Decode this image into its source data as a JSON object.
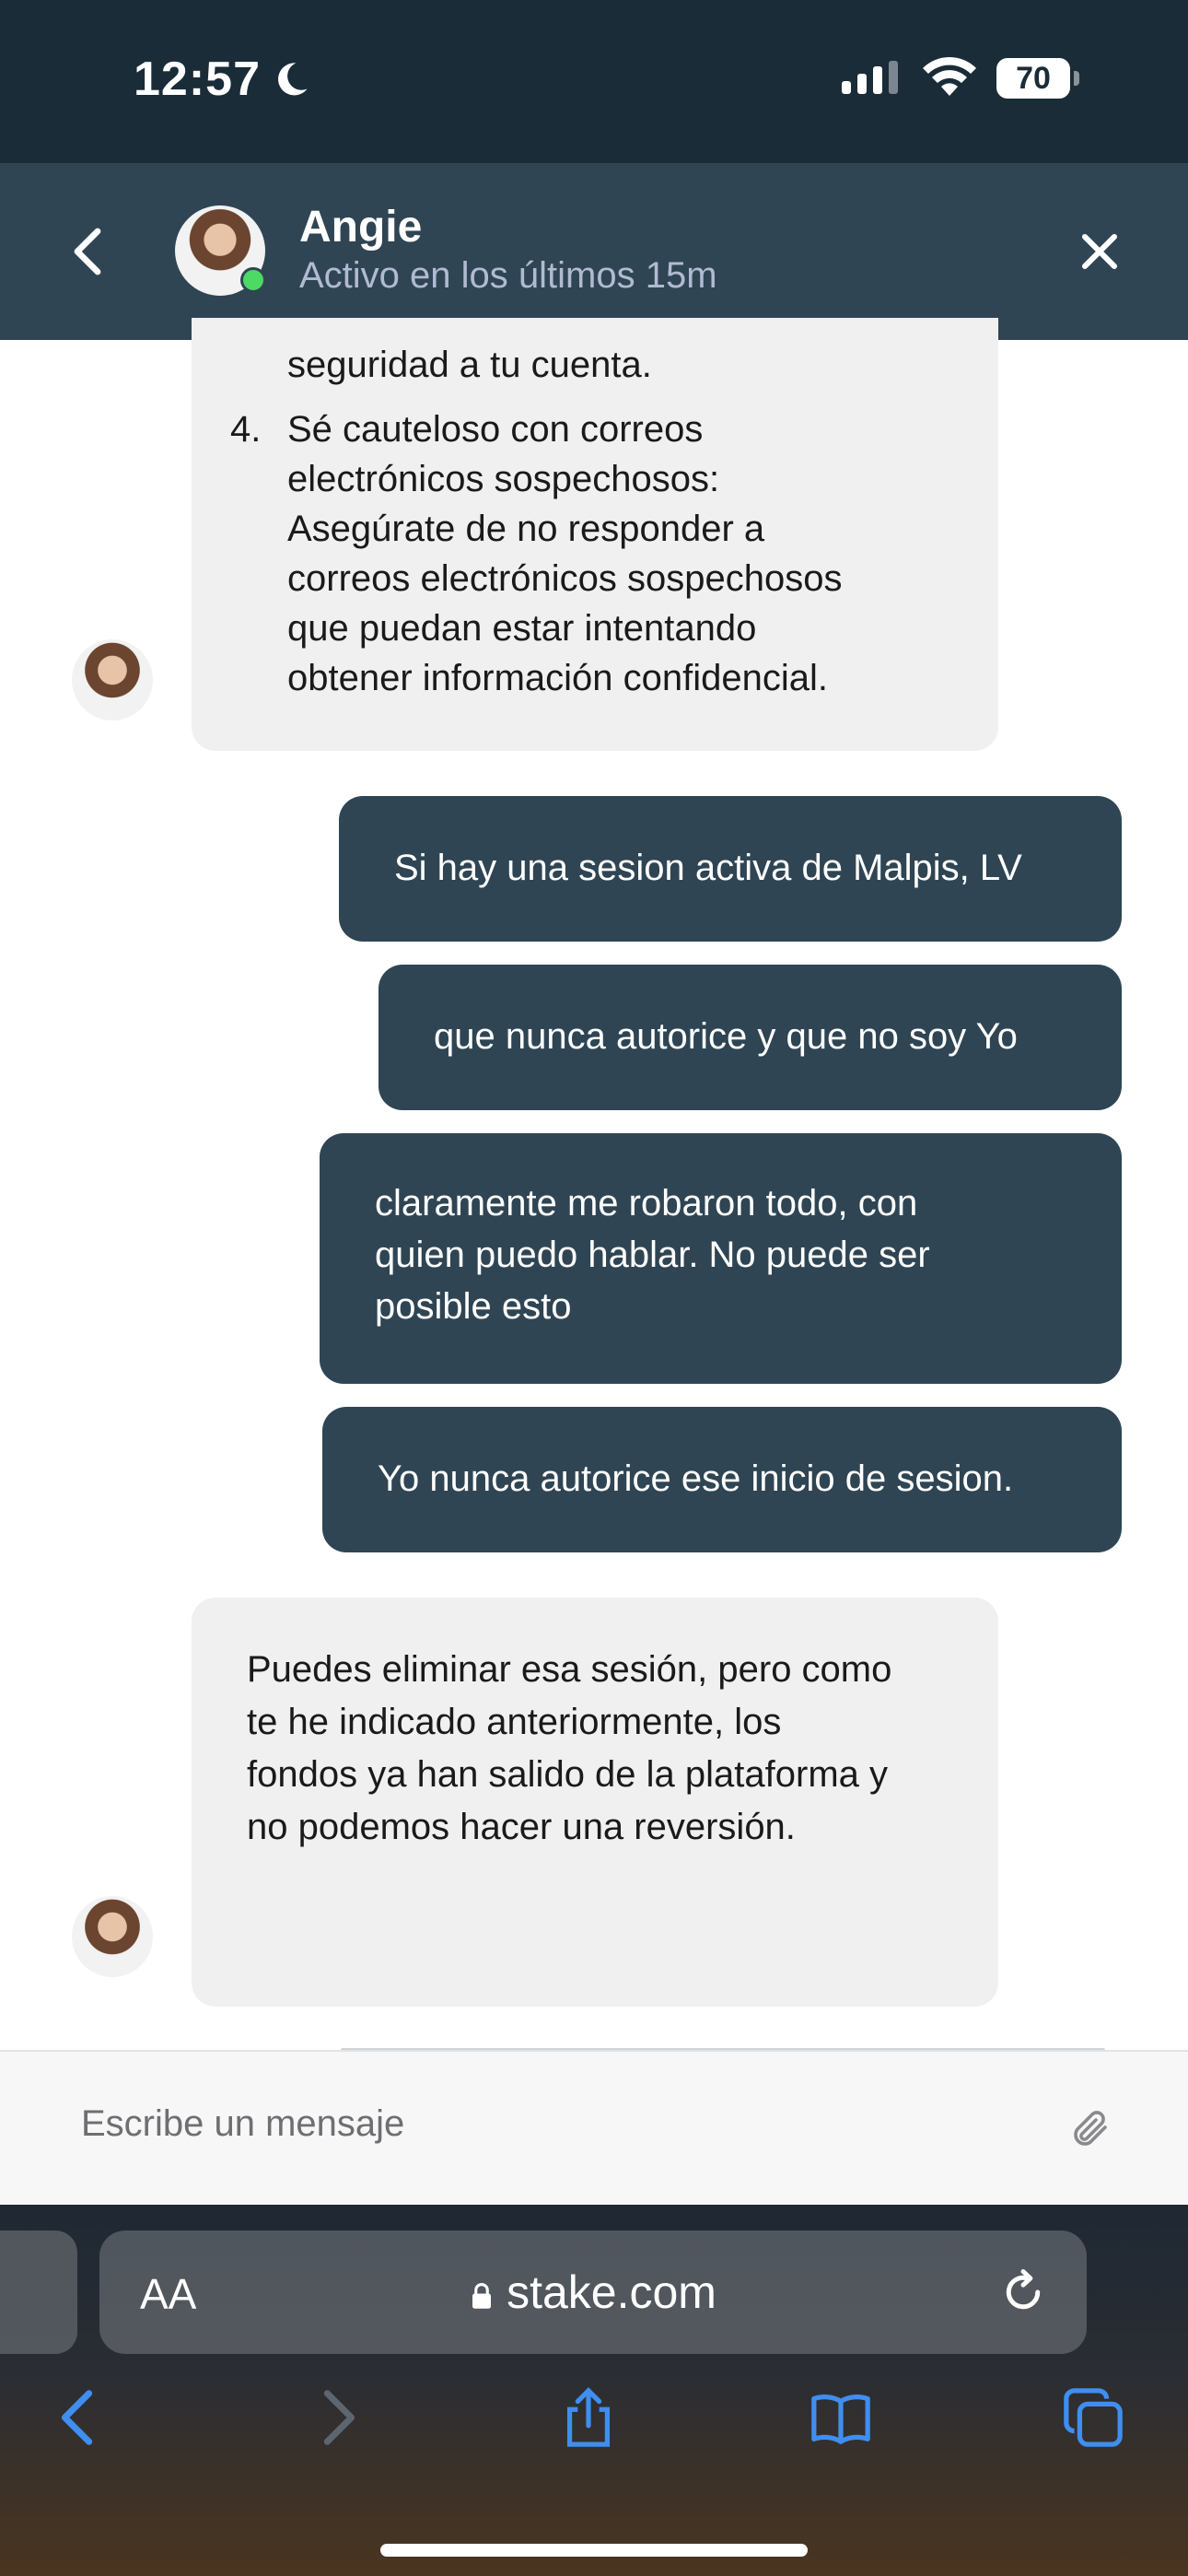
{
  "status_bar": {
    "time": "12:57",
    "battery": "70"
  },
  "header": {
    "agent_name": "Angie",
    "agent_status": "Activo en los últimos 15m"
  },
  "messages": {
    "first": {
      "lead_in": "seguridad a tu cuenta.",
      "item_number": "4.",
      "item_lines": [
        "Sé cauteloso con correos",
        "electrónicos sospechosos:",
        "Asegúrate de no responder a",
        "correos electrónicos sospechosos",
        "que puedan estar intentando",
        "obtener información confidencial."
      ]
    },
    "user": [
      {
        "lines": [
          "Si hay una sesion activa de Malpis, LV"
        ]
      },
      {
        "lines": [
          "que nunca autorice y que no soy Yo"
        ]
      },
      {
        "lines": [
          "claramente me robaron todo, con",
          "quien puedo hablar. No puede ser",
          "posible esto"
        ]
      },
      {
        "lines": [
          "Yo nunca autorice ese inicio de sesion."
        ]
      }
    ],
    "agent_reply": {
      "lines": [
        "Puedes eliminar esa sesión, pero como",
        "te he indicado anteriormente, los",
        "fondos ya han salido de la plataforma y",
        "no podemos hacer una reversión."
      ]
    }
  },
  "composer": {
    "placeholder": "Escribe un mensaje"
  },
  "browser": {
    "text_size_label": "AA",
    "domain": "stake.com"
  },
  "icons": {
    "back": "chevron-left-icon",
    "close": "close-icon",
    "attach": "paperclip-icon",
    "lock": "lock-icon",
    "reload": "reload-icon",
    "browser_back": "chevron-left-icon",
    "browser_forward": "chevron-right-icon",
    "share": "share-icon",
    "bookmarks": "book-icon",
    "tabs": "tabs-icon"
  },
  "colors": {
    "header_bg": "#2f4553",
    "status_bar_bg": "#1a2c38",
    "user_bubble": "#2f4553",
    "agent_bubble": "#f0f0f0",
    "online": "#4cd964"
  }
}
